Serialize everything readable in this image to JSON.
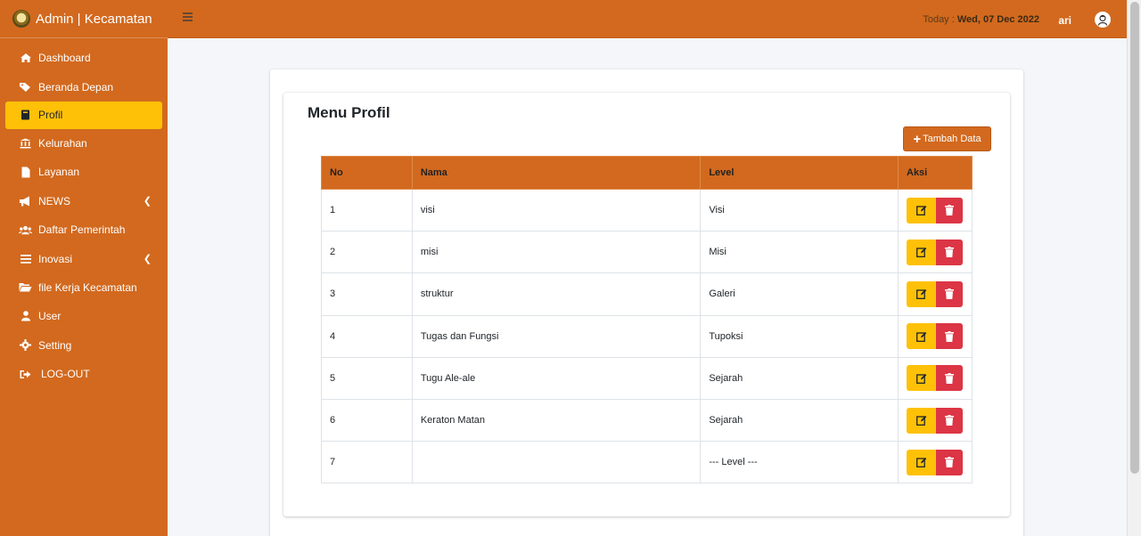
{
  "brand": {
    "title": "Admin | Kecamatan"
  },
  "sidebar": {
    "items": [
      {
        "label": "Dashboard",
        "icon": "home-icon"
      },
      {
        "label": "Beranda Depan",
        "icon": "tags-icon"
      },
      {
        "label": "Profil",
        "icon": "book-icon",
        "active": true
      },
      {
        "label": "Kelurahan",
        "icon": "landmark-icon"
      },
      {
        "label": "Layanan",
        "icon": "file-icon"
      },
      {
        "label": "NEWS",
        "icon": "bullhorn-icon",
        "has_children": true
      },
      {
        "label": "Daftar Pemerintah",
        "icon": "users-icon"
      },
      {
        "label": "Inovasi",
        "icon": "bars-icon",
        "has_children": true
      },
      {
        "label": "file Kerja Kecamatan",
        "icon": "folder-open-icon"
      },
      {
        "label": "User",
        "icon": "user-icon"
      },
      {
        "label": "Setting",
        "icon": "gear-icon"
      },
      {
        "label": "LOG-OUT",
        "icon": "sign-out-icon"
      }
    ]
  },
  "topnav": {
    "today_label": "Today :",
    "today_value": "Wed, 07 Dec 2022",
    "username": "ari"
  },
  "main": {
    "title": "Menu Profil",
    "add_button": "Tambah Data",
    "table": {
      "headers": [
        "No",
        "Nama",
        "Level",
        "Aksi"
      ],
      "rows": [
        {
          "no": "1",
          "nama": "visi",
          "level": "Visi"
        },
        {
          "no": "2",
          "nama": "misi",
          "level": "Misi"
        },
        {
          "no": "3",
          "nama": "struktur",
          "level": "Galeri"
        },
        {
          "no": "4",
          "nama": "Tugas dan Fungsi",
          "level": "Tupoksi"
        },
        {
          "no": "5",
          "nama": "Tugu Ale-ale",
          "level": "Sejarah"
        },
        {
          "no": "6",
          "nama": "Keraton Matan",
          "level": "Sejarah"
        },
        {
          "no": "7",
          "nama": "",
          "level": "--- Level ---"
        }
      ]
    }
  },
  "colors": {
    "primary": "#d2691e",
    "active": "#ffc107",
    "danger": "#dc3545",
    "background": "#f4f6f9"
  }
}
